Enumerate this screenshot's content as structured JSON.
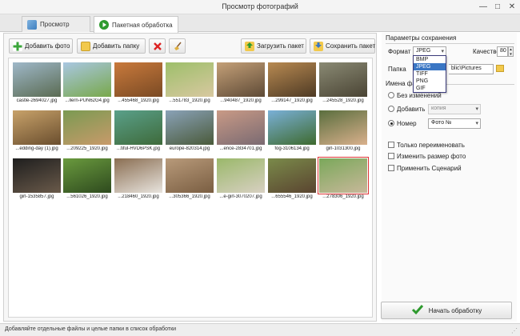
{
  "window": {
    "title": "Просмотр фотографий",
    "controls": {
      "minimize": "—",
      "maximize": "□",
      "close": "✕"
    }
  },
  "tabs": [
    {
      "label": "Просмотр",
      "active": false,
      "icon": "photos-icon"
    },
    {
      "label": "Пакетная обработка",
      "active": true,
      "icon": "batch-play-icon"
    }
  ],
  "toolbar": {
    "add_photo": "Добавить фото",
    "add_folder": "Добавить папку",
    "remove_icon": "remove-x-icon",
    "clear_icon": "broom-icon",
    "load_batch": "Загрузить пакет",
    "save_batch": "Сохранить пакет"
  },
  "gallery": [
    {
      "caption": "castle-2694027.jpg",
      "colors": [
        "#9fb8c9",
        "#5a6b52"
      ],
      "selected": false
    },
    {
      "caption": "...llern-PUN62G4.jpg",
      "colors": [
        "#a9c7e2",
        "#78a84a"
      ],
      "selected": false
    },
    {
      "caption": "...455468_1920.jpg",
      "colors": [
        "#c97a3c",
        "#7a4a24"
      ],
      "selected": false
    },
    {
      "caption": "...551783_1920.jpg",
      "colors": [
        "#9dbf6a",
        "#d8c8a0"
      ],
      "selected": false
    },
    {
      "caption": "...940487_1920.jpg",
      "colors": [
        "#c4a078",
        "#5e4a36"
      ],
      "selected": false
    },
    {
      "caption": "...299147_1920.jpg",
      "colors": [
        "#b88a52",
        "#4e3a24"
      ],
      "selected": false
    },
    {
      "caption": "...245528_1920.jpg",
      "colors": [
        "#8a8a74",
        "#4a4434"
      ],
      "selected": false
    },
    {
      "caption": "...edding-day (1).jpg",
      "colors": [
        "#c8a26a",
        "#6a4e2e"
      ],
      "selected": false
    },
    {
      "caption": "...209225_1920.jpg",
      "colors": [
        "#7a9a52",
        "#c89a6a"
      ],
      "selected": false
    },
    {
      "caption": "...tiful-HVD6PSK.jpg",
      "colors": [
        "#5aa08a",
        "#3e6a3a"
      ],
      "selected": false
    },
    {
      "caption": "europe-820314.jpg",
      "colors": [
        "#8aa2b8",
        "#4a5a3a"
      ],
      "selected": false
    },
    {
      "caption": "...ence-2834701.jpg",
      "colors": [
        "#c99a86",
        "#7a6a72"
      ],
      "selected": false
    },
    {
      "caption": "fog-3106134.jpg",
      "colors": [
        "#7ab0d8",
        "#3e6a2e"
      ],
      "selected": false
    },
    {
      "caption": "girl-1031300.jpg",
      "colors": [
        "#5a6e3e",
        "#d9b08c"
      ],
      "selected": false
    },
    {
      "caption": "girl-1535857.jpg",
      "colors": [
        "#1e1e1e",
        "#6a5a4a"
      ],
      "selected": false
    },
    {
      "caption": "...561026_1920.jpg",
      "colors": [
        "#6a9a3e",
        "#2e4a1e"
      ],
      "selected": false
    },
    {
      "caption": "...218460_1920.jpg",
      "colors": [
        "#8a6e52",
        "#e8e4de"
      ],
      "selected": false
    },
    {
      "caption": "...305366_1920.jpg",
      "colors": [
        "#b89a7a",
        "#7a5e42"
      ],
      "selected": false
    },
    {
      "caption": "...e-girl-3070207.jpg",
      "colors": [
        "#9ab86a",
        "#d8d0c2"
      ],
      "selected": false
    },
    {
      "caption": "...655546_1920.jpg",
      "colors": [
        "#7a8a4a",
        "#5a4430"
      ],
      "selected": false
    },
    {
      "caption": "...278306_1920.jpg",
      "colors": [
        "#7aa85a",
        "#c8b89a"
      ],
      "selected": true
    }
  ],
  "settings": {
    "save_params_title": "Параметры сохранения",
    "format_label": "Формат",
    "format_value": "JPEG",
    "format_options": [
      "BMP",
      "JPEG",
      "TIFF",
      "PNG",
      "GIF"
    ],
    "format_highlighted": "JPEG",
    "quality_label": "Качество",
    "quality_value": "80",
    "folder_label": "Папка",
    "folder_value": "blic\\Pictures",
    "file_names_title": "Имена фа",
    "no_change_label": "Без изменений",
    "add_label": "Добавить",
    "add_value": "копия",
    "number_label": "Номер",
    "number_value": "Фото №",
    "name_mode": "number",
    "only_rename": "Только переименовать",
    "resize": "Изменить размер фото",
    "apply_scenario": "Применить Сценарий"
  },
  "start_button": "Начать обработку",
  "status": "Добавляйте отдельные файлы и целые папки в список обработки",
  "colors": {
    "accent_green": "#2e9a2e",
    "selection_red": "#d33333",
    "dropdown_highlight": "#3a76c4"
  }
}
